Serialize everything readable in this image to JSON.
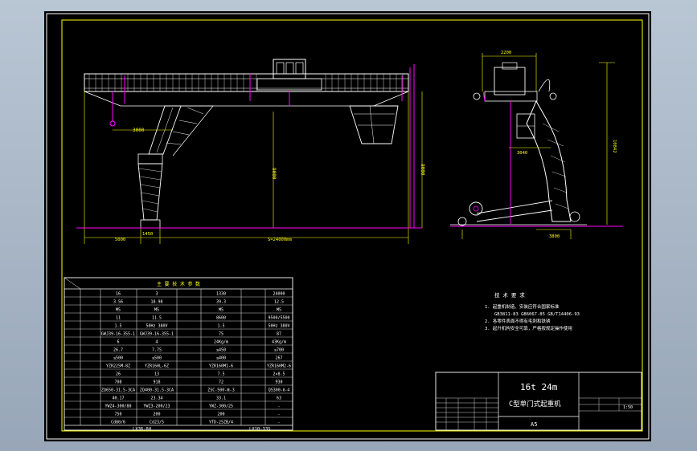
{
  "drawing": {
    "title_line1": "16t 24m",
    "title_line2": "C型单门式起重机",
    "sheet_size": "A5",
    "scale": "1:50"
  },
  "tech_requirements": {
    "title": "技 术 要 求",
    "items": [
      "1. 起重机制造、安装应符合国家标准",
      "GB3811-83 GB6067-85 GB/T14406-93",
      "2. 各零件表面不得有毛刺和铁锈",
      "3. 起升机构安全可靠，严格按规定操作使用"
    ]
  },
  "front_view": {
    "dims": {
      "top_overall": "3000",
      "height_a": "9000",
      "height_b": "9000",
      "left_leg": "1450",
      "left_span": "5000",
      "span": "S=24000mm"
    }
  },
  "side_view": {
    "dims": {
      "top_width": "2200",
      "mid_width": "3040",
      "height": "10842",
      "base_wheel": "3800"
    }
  },
  "params_table": {
    "title": "主 要 技 术 参 数",
    "rows": [
      [
        "16",
        "3",
        "1330",
        "24000"
      ],
      [
        "3.56",
        "18.98",
        "39.3",
        "12.5"
      ],
      [
        "M5",
        "M5",
        "M5",
        "M5"
      ],
      [
        "11",
        "11.5",
        "8600",
        "9500/5500"
      ],
      [
        "1.5",
        "50Hz 380V",
        "1.5",
        "50Hz 380V"
      ],
      [
        "GWJ39-16-355-1",
        "GWJ39-16-355-1",
        "75",
        "87"
      ],
      [
        "6",
        "4",
        "24Kg/m",
        "43Kg/m"
      ],
      [
        "26.7",
        "7.75",
        "≤450",
        "≤700"
      ],
      [
        "≤500",
        "≤500",
        "≤400",
        "267"
      ],
      [
        "YZR225M-8Z",
        "YZR160L-6Z",
        "YZR160M1-6",
        "YZR160M2-6"
      ],
      [
        "26",
        "13",
        "7.5",
        "2×8.5"
      ],
      [
        "708",
        "918",
        "72",
        "930"
      ],
      [
        "ZQ650-31.5-3CA",
        "ZQ400-31.5-3CA",
        "ZSC-500-Ⅲ-3",
        "QS300-Ⅱ-4"
      ],
      [
        "40.17",
        "23.34",
        "33.1",
        "63"
      ],
      [
        "YWZ4-300/80",
        "YWZ3-200/23",
        "YWZ-300/25",
        "-"
      ],
      [
        "750",
        "200",
        "200",
        "-"
      ],
      [
        "Cd80/6",
        "Cd23/5",
        "YTD-25ZB/4",
        "-"
      ]
    ],
    "footer_left": "LX36-84",
    "footer_right": "LX10-33S"
  }
}
